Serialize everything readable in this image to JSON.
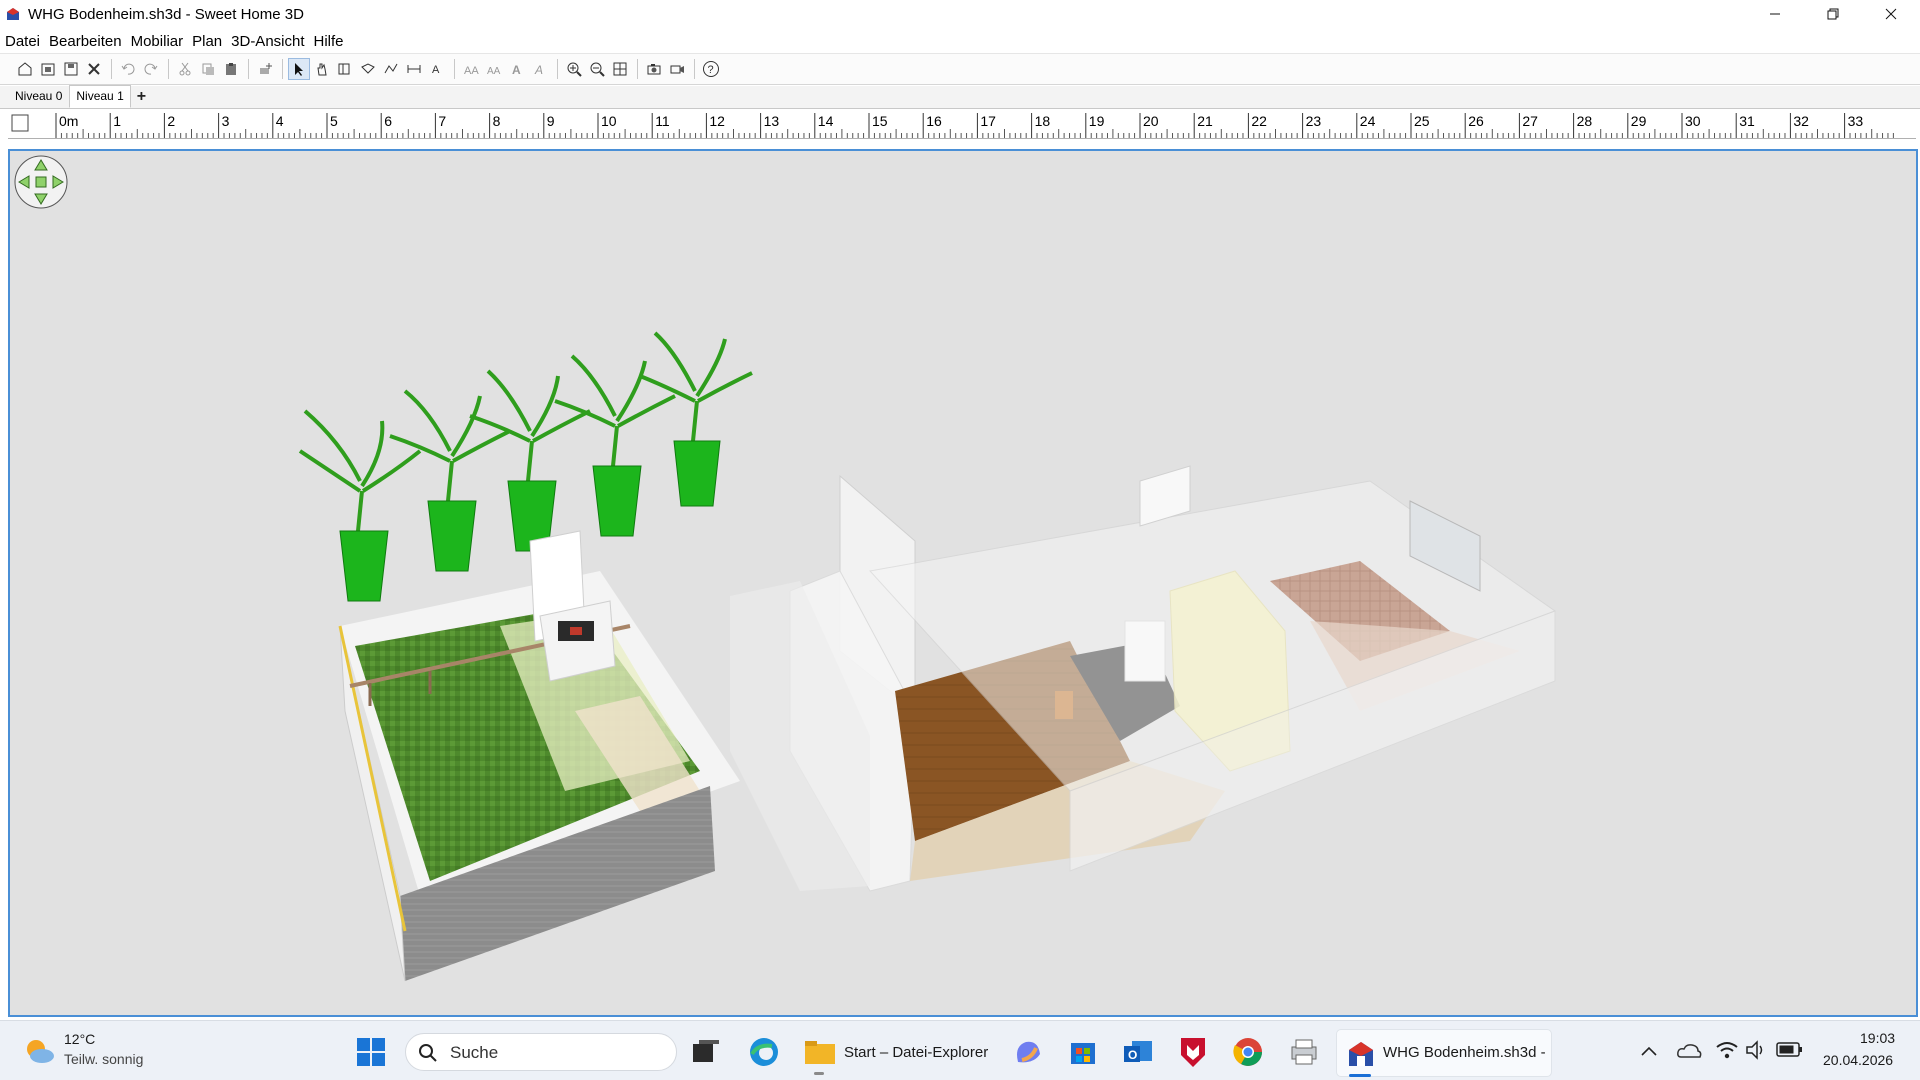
{
  "window": {
    "title": "WHG Bodenheim.sh3d - Sweet Home 3D"
  },
  "menu": [
    "Datei",
    "Bearbeiten",
    "Mobiliar",
    "Plan",
    "3D-Ansicht",
    "Hilfe"
  ],
  "levels": {
    "tabs": [
      "Niveau 0",
      "Niveau 1"
    ],
    "active": 1,
    "add": "+"
  },
  "ruler": {
    "labels": [
      "0m",
      "1",
      "2",
      "3",
      "4",
      "5",
      "6",
      "7",
      "8",
      "9",
      "10",
      "11",
      "12",
      "13",
      "14",
      "15",
      "16",
      "17",
      "18",
      "19",
      "20",
      "21",
      "22",
      "23",
      "24",
      "25",
      "26",
      "27",
      "28",
      "29",
      "30",
      "31",
      "32",
      "33"
    ]
  },
  "taskbar": {
    "weather": {
      "temp": "12°C",
      "desc": "Teilw. sonnig"
    },
    "search_placeholder": "Suche",
    "explorer_label": "Start – Datei-Explorer",
    "active_app_label": "WHG Bodenheim.sh3d -",
    "time": "19:03",
    "date": "20.04.2026"
  },
  "colors": {
    "viewport_bg": "#e1e1e1",
    "viewport_border": "#4a8fd6",
    "taskbar_bg": "#edf1f7"
  }
}
